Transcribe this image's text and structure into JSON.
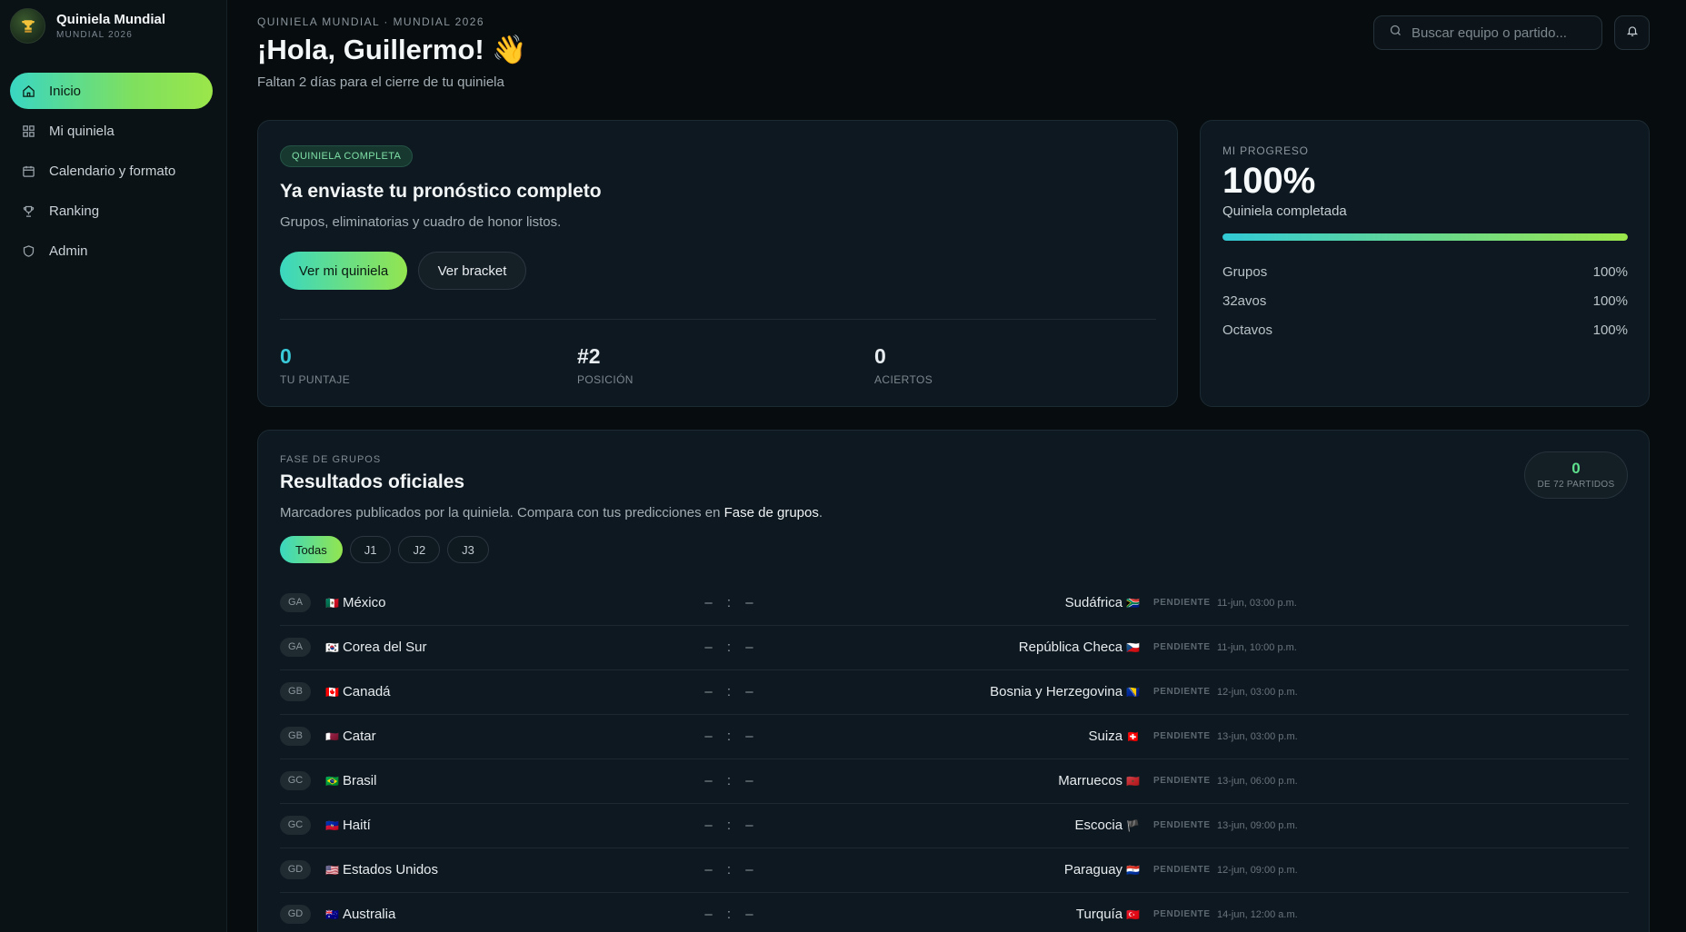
{
  "brand": {
    "title": "Quiniela Mundial",
    "subtitle": "MUNDIAL 2026",
    "icon": "trophy-icon"
  },
  "nav": [
    {
      "label": "Inicio",
      "icon": "home-icon",
      "active": true
    },
    {
      "label": "Mi quiniela",
      "icon": "grid-icon",
      "active": false
    },
    {
      "label": "Calendario y formato",
      "icon": "calendar-icon",
      "active": false
    },
    {
      "label": "Ranking",
      "icon": "trophy-icon",
      "active": false
    },
    {
      "label": "Admin",
      "icon": "shield-icon",
      "active": false
    }
  ],
  "header": {
    "eyebrow": "QUINIELA MUNDIAL · MUNDIAL 2026",
    "greeting": "¡Hola, Guillermo! 👋",
    "subtitle": "Faltan 2 días para el cierre de tu quiniela",
    "search_placeholder": "Buscar equipo o partido..."
  },
  "hero": {
    "badge": "QUINIELA COMPLETA",
    "title": "Ya enviaste tu pronóstico completo",
    "subtitle": "Grupos, eliminatorias y cuadro de honor listos.",
    "primary_button": "Ver mi quiniela",
    "secondary_button": "Ver bracket",
    "stats": [
      {
        "value": "0",
        "label": "TU PUNTAJE",
        "color": "#39c9d8"
      },
      {
        "value": "#2",
        "label": "POSICIÓN",
        "color": "#f2f5f6"
      },
      {
        "value": "0",
        "label": "ACIERTOS",
        "color": "#f2f5f6"
      }
    ]
  },
  "progress": {
    "eyebrow": "MI PROGRESO",
    "value": "100%",
    "fill_fraction": 1.0,
    "label": "Quiniela completada",
    "rows": [
      {
        "name": "Grupos",
        "value": "100%"
      },
      {
        "name": "32avos",
        "value": "100%"
      },
      {
        "name": "Octavos",
        "value": "100%"
      }
    ]
  },
  "results": {
    "eyebrow": "FASE DE GRUPOS",
    "title": "Resultados oficiales",
    "subtitle_prefix": "Marcadores publicados por la quiniela. Compara con tus predicciones en ",
    "subtitle_link": "Fase de grupos",
    "subtitle_suffix": ".",
    "counter_value": "0",
    "counter_label": "DE 72 PARTIDOS",
    "filters": [
      "Todas",
      "J1",
      "J2",
      "J3"
    ],
    "score_placeholder": "– : –",
    "matches": [
      {
        "group": "GA",
        "home": "México",
        "home_flag": "🇲🇽",
        "away": "Sudáfrica",
        "away_flag": "🇿🇦",
        "status": "PENDIENTE",
        "datetime": "11-jun, 03:00 p.m."
      },
      {
        "group": "GA",
        "home": "Corea del Sur",
        "home_flag": "🇰🇷",
        "away": "República Checa",
        "away_flag": "🇨🇿",
        "status": "PENDIENTE",
        "datetime": "11-jun, 10:00 p.m."
      },
      {
        "group": "GB",
        "home": "Canadá",
        "home_flag": "🇨🇦",
        "away": "Bosnia y Herzegovina",
        "away_flag": "🇧🇦",
        "status": "PENDIENTE",
        "datetime": "12-jun, 03:00 p.m."
      },
      {
        "group": "GB",
        "home": "Catar",
        "home_flag": "🇶🇦",
        "away": "Suiza",
        "away_flag": "🇨🇭",
        "status": "PENDIENTE",
        "datetime": "13-jun, 03:00 p.m."
      },
      {
        "group": "GC",
        "home": "Brasil",
        "home_flag": "🇧🇷",
        "away": "Marruecos",
        "away_flag": "🇲🇦",
        "status": "PENDIENTE",
        "datetime": "13-jun, 06:00 p.m."
      },
      {
        "group": "GC",
        "home": "Haití",
        "home_flag": "🇭🇹",
        "away": "Escocia",
        "away_flag": "🏴",
        "status": "PENDIENTE",
        "datetime": "13-jun, 09:00 p.m."
      },
      {
        "group": "GD",
        "home": "Estados Unidos",
        "home_flag": "🇺🇸",
        "away": "Paraguay",
        "away_flag": "🇵🇾",
        "status": "PENDIENTE",
        "datetime": "12-jun, 09:00 p.m."
      },
      {
        "group": "GD",
        "home": "Australia",
        "home_flag": "🇦🇺",
        "away": "Turquía",
        "away_flag": "🇹🇷",
        "status": "PENDIENTE",
        "datetime": "14-jun, 12:00 a.m."
      }
    ]
  }
}
